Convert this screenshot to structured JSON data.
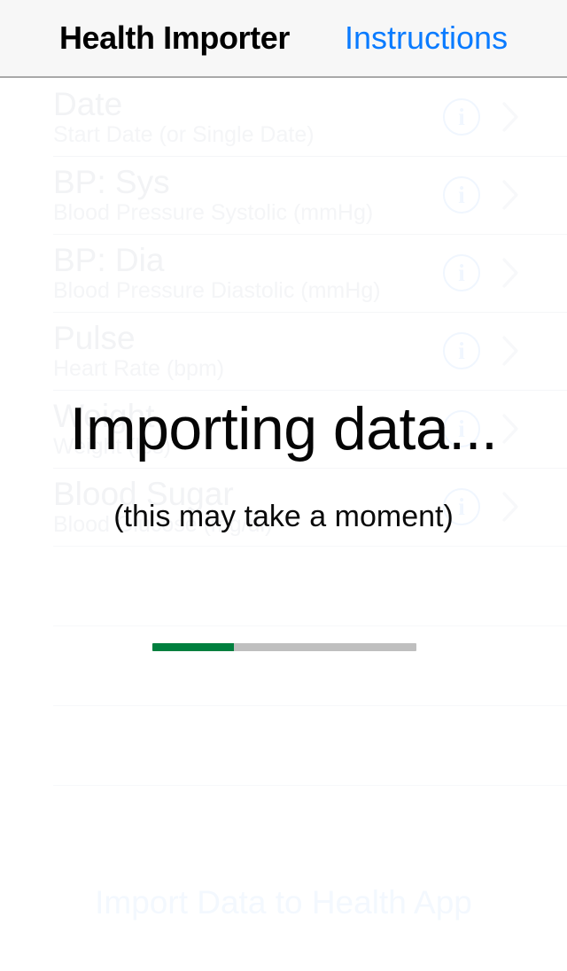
{
  "navbar": {
    "title": "Health Importer",
    "instructions_label": "Instructions"
  },
  "fields": [
    {
      "label": "Date",
      "subtitle": "Start Date (or Single Date)",
      "info_icon": "info-circle-icon",
      "disclosure_icon": "chevron-right-icon"
    },
    {
      "label": "BP: Sys",
      "subtitle": "Blood Pressure Systolic (mmHg)",
      "info_icon": "info-circle-icon",
      "disclosure_icon": "chevron-right-icon"
    },
    {
      "label": "BP: Dia",
      "subtitle": "Blood Pressure Diastolic (mmHg)",
      "info_icon": "info-circle-icon",
      "disclosure_icon": "chevron-right-icon"
    },
    {
      "label": "Pulse",
      "subtitle": "Heart Rate (bpm)",
      "info_icon": "info-circle-icon",
      "disclosure_icon": "chevron-right-icon"
    },
    {
      "label": "Weight",
      "subtitle": "Weight (lbs)",
      "info_icon": "info-circle-icon",
      "disclosure_icon": "chevron-right-icon"
    },
    {
      "label": "Blood Sugar",
      "subtitle": "Blood Glucose (mg/dl)",
      "info_icon": "info-circle-icon",
      "disclosure_icon": "chevron-right-icon"
    }
  ],
  "import_button": {
    "label": "Import Data to Health App"
  },
  "overlay": {
    "title": "Importing data...",
    "subtitle": "(this may take a moment)",
    "progress": {
      "percent": 31,
      "fill_color": "#007f3e",
      "track_color": "#bfbfbf"
    }
  },
  "colors": {
    "accent_blue": "#0a7bff",
    "navbar_background": "#f7f7f7",
    "progress_green": "#007f3e",
    "text_primary": "#000000"
  }
}
